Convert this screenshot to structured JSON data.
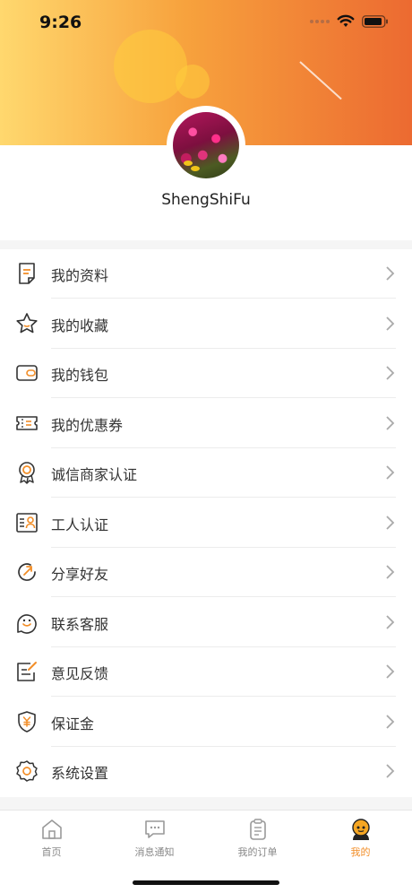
{
  "status_bar": {
    "time": "9:26"
  },
  "profile": {
    "username": "ShengShiFu"
  },
  "menu": {
    "items": [
      {
        "label": "我的资料",
        "icon": "document-icon"
      },
      {
        "label": "我的收藏",
        "icon": "star-icon"
      },
      {
        "label": "我的钱包",
        "icon": "wallet-icon"
      },
      {
        "label": "我的优惠券",
        "icon": "coupon-icon"
      },
      {
        "label": "诚信商家认证",
        "icon": "badge-icon"
      },
      {
        "label": "工人认证",
        "icon": "id-card-icon"
      },
      {
        "label": "分享好友",
        "icon": "share-icon"
      },
      {
        "label": "联系客服",
        "icon": "smile-icon"
      },
      {
        "label": "意见反馈",
        "icon": "feedback-icon"
      },
      {
        "label": "保证金",
        "icon": "shield-yen-icon"
      },
      {
        "label": "系统设置",
        "icon": "gear-icon"
      }
    ]
  },
  "tabbar": {
    "tabs": [
      {
        "label": "首页",
        "icon": "home-icon",
        "active": false
      },
      {
        "label": "消息通知",
        "icon": "message-icon",
        "active": false
      },
      {
        "label": "我的订单",
        "icon": "clipboard-icon",
        "active": false
      },
      {
        "label": "我的",
        "icon": "profile-face-icon",
        "active": true
      }
    ]
  },
  "colors": {
    "accent": "#f28e28",
    "icon_dark": "#333333",
    "header_start": "#ffd86e",
    "header_end": "#ec6a31"
  }
}
